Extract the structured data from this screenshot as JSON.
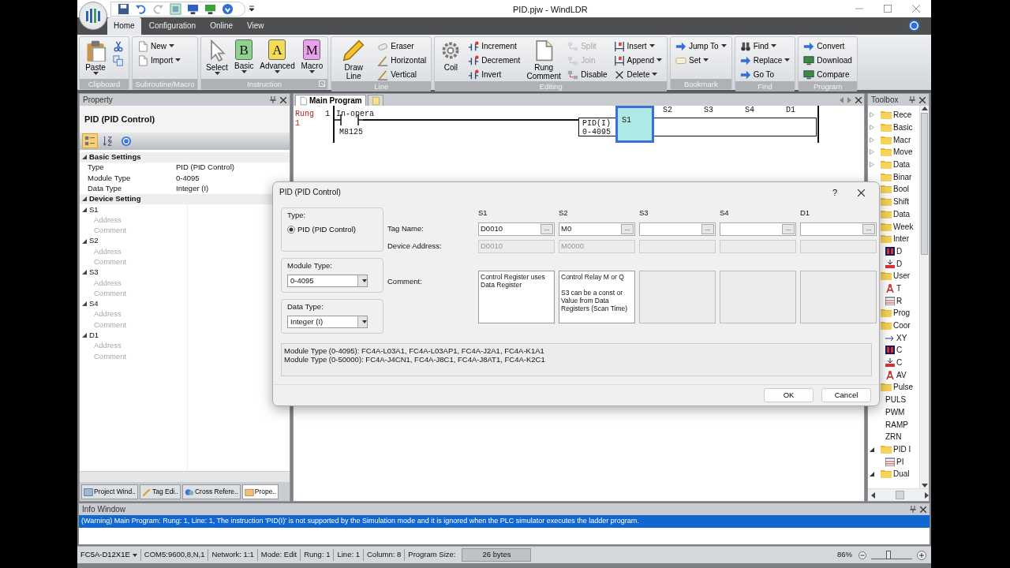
{
  "window": {
    "title": "PID.pjw - WindLDR"
  },
  "ribbon_tabs": [
    {
      "label": "Home",
      "selected": true
    },
    {
      "label": "Configuration",
      "selected": false
    },
    {
      "label": "Online",
      "selected": false
    },
    {
      "label": "View",
      "selected": false
    }
  ],
  "ribbon_groups": [
    {
      "label": "Clipboard",
      "launcher": false,
      "items": [
        {
          "kind": "large",
          "label": "Paste",
          "dropdown": true,
          "disabled": false
        },
        {
          "kind": "icon",
          "dropdown": false,
          "disabled": false
        },
        {
          "kind": "icon",
          "dropdown": false,
          "disabled": false
        }
      ]
    },
    {
      "label": "Subroutine/Macro",
      "launcher": false,
      "items": [
        {
          "kind": "small",
          "label": "New",
          "dropdown": true,
          "disabled": false
        },
        {
          "kind": "small",
          "label": "Import",
          "dropdown": true,
          "disabled": false
        }
      ]
    },
    {
      "label": "Instruction",
      "launcher": true,
      "items": [
        {
          "kind": "large",
          "label": "Select",
          "dropdown": true,
          "disabled": false
        },
        {
          "kind": "large",
          "label": "Basic",
          "glyph": "B",
          "dropdown": true,
          "disabled": false
        },
        {
          "kind": "large",
          "label": "Advanced",
          "glyph": "A",
          "dropdown": true,
          "disabled": false
        },
        {
          "kind": "large",
          "label": "Macro",
          "glyph": "M",
          "dropdown": true,
          "disabled": false
        }
      ]
    },
    {
      "label": "Line",
      "launcher": false,
      "items": [
        {
          "kind": "large",
          "label": "Draw Line",
          "dropdown": false,
          "disabled": false
        },
        {
          "kind": "small",
          "label": "Eraser",
          "dropdown": false,
          "disabled": false
        },
        {
          "kind": "small",
          "label": "Horizontal",
          "dropdown": false,
          "disabled": false
        },
        {
          "kind": "small",
          "label": "Vertical",
          "dropdown": false,
          "disabled": false
        }
      ]
    },
    {
      "label": "Editing",
      "launcher": false,
      "items": [
        {
          "kind": "large",
          "label": "Coil",
          "dropdown": false,
          "disabled": false
        },
        {
          "kind": "small",
          "label": "Increment",
          "dropdown": false,
          "disabled": false
        },
        {
          "kind": "small",
          "label": "Decrement",
          "dropdown": false,
          "disabled": false
        },
        {
          "kind": "small",
          "label": "Invert",
          "dropdown": false,
          "disabled": false
        },
        {
          "kind": "large",
          "label": "Rung Comment",
          "dropdown": false,
          "disabled": false
        },
        {
          "kind": "small",
          "label": "Split",
          "dropdown": false,
          "disabled": true
        },
        {
          "kind": "small",
          "label": "Join",
          "dropdown": false,
          "disabled": true
        },
        {
          "kind": "small",
          "label": "Disable",
          "dropdown": false,
          "disabled": false
        },
        {
          "kind": "small",
          "label": "Insert",
          "dropdown": true,
          "disabled": false
        },
        {
          "kind": "small",
          "label": "Append",
          "dropdown": true,
          "disabled": false
        },
        {
          "kind": "small",
          "label": "Delete",
          "dropdown": true,
          "disabled": false
        }
      ]
    },
    {
      "label": "Bookmark",
      "launcher": false,
      "items": [
        {
          "kind": "small",
          "label": "Jump To",
          "dropdown": true,
          "disabled": false
        },
        {
          "kind": "small",
          "label": "Set",
          "dropdown": true,
          "disabled": false
        }
      ]
    },
    {
      "label": "Find",
      "launcher": false,
      "items": [
        {
          "kind": "small",
          "label": "Find",
          "dropdown": true,
          "disabled": false
        },
        {
          "kind": "small",
          "label": "Replace",
          "dropdown": true,
          "disabled": false
        },
        {
          "kind": "small",
          "label": "Go To",
          "dropdown": false,
          "disabled": false
        }
      ]
    },
    {
      "label": "Program",
      "launcher": false,
      "items": [
        {
          "kind": "small",
          "label": "Convert",
          "dropdown": false,
          "disabled": false
        },
        {
          "kind": "small",
          "label": "Download",
          "dropdown": false,
          "disabled": false
        },
        {
          "kind": "small",
          "label": "Compare",
          "dropdown": false,
          "disabled": false
        }
      ]
    }
  ],
  "property_panel": {
    "title": "Property",
    "heading": "PID (PID Control)",
    "toolbar": [
      {
        "selected": true
      },
      {
        "selected": false
      },
      {
        "selected": false
      }
    ],
    "grid": [
      {
        "kind": "category",
        "label": "Basic Settings",
        "expanded": true,
        "children": [
          {
            "name": "Type",
            "value": "PID (PID Control)",
            "disabled": false
          },
          {
            "name": "Module Type",
            "value": "0-4095",
            "disabled": false
          },
          {
            "name": "Data Type",
            "value": "Integer (I)",
            "disabled": false
          }
        ]
      },
      {
        "kind": "category",
        "label": "Device Setting",
        "expanded": true
      },
      {
        "kind": "group",
        "label": "S1",
        "expanded": true,
        "children": [
          {
            "name": "Address",
            "disabled": true
          },
          {
            "name": "Comment",
            "disabled": true
          }
        ]
      },
      {
        "kind": "group",
        "label": "S2",
        "expanded": true,
        "children": [
          {
            "name": "Address",
            "disabled": true
          },
          {
            "name": "Comment",
            "disabled": true
          }
        ]
      },
      {
        "kind": "group",
        "label": "S3",
        "expanded": true,
        "children": [
          {
            "name": "Address",
            "disabled": true
          },
          {
            "name": "Comment",
            "disabled": true
          }
        ]
      },
      {
        "kind": "group",
        "label": "S4",
        "expanded": true,
        "children": [
          {
            "name": "Address",
            "disabled": true
          },
          {
            "name": "Comment",
            "disabled": true
          }
        ]
      },
      {
        "kind": "group",
        "label": "D1",
        "expanded": true,
        "children": [
          {
            "name": "Address",
            "disabled": true
          },
          {
            "name": "Comment",
            "disabled": true
          }
        ]
      }
    ],
    "tabs": [
      {
        "label": "Project Wind..",
        "selected": false
      },
      {
        "label": "Tag Edi..",
        "selected": false
      },
      {
        "label": "Cross Refere..",
        "selected": false
      },
      {
        "label": "Prope..",
        "selected": true
      }
    ]
  },
  "editor": {
    "tabs": [
      {
        "label": "Main Program",
        "selected": true
      },
      {
        "selected": false
      }
    ],
    "rung_header": "Rung",
    "rung_number": "1",
    "line_number": "1",
    "contact": {
      "label": "In-opera",
      "device": "M8125"
    },
    "instruction": {
      "name": "PID(I)",
      "module": "0-4095",
      "operands": [
        {
          "label": "S1",
          "selected": true
        },
        {
          "label": "S2",
          "selected": false
        },
        {
          "label": "S3",
          "selected": false
        },
        {
          "label": "S4",
          "selected": false
        },
        {
          "label": "D1",
          "selected": false
        }
      ]
    }
  },
  "dialog": {
    "title": "PID (PID Control)",
    "help": "?",
    "type_group": {
      "label": "Type:",
      "options": [
        {
          "label": "PID (PID Control)",
          "selected": true
        }
      ]
    },
    "module_type": {
      "label": "Module Type:",
      "value": "0-4095"
    },
    "data_type": {
      "label": "Data Type:",
      "value": "Integer (I)"
    },
    "row_labels": {
      "tag": "Tag Name:",
      "address": "Device Address:",
      "comment": "Comment:"
    },
    "operands": [
      {
        "label": "S1",
        "tag": "D0010",
        "browse": "...",
        "address": "D0010",
        "comment": "Control Register uses Data Register",
        "comment_disabled": false
      },
      {
        "label": "S2",
        "tag": "M0",
        "browse": "...",
        "address": "M0000",
        "comment": "Control Relay M or Q\n\nS3 can be a const or Value from Data Registers (Scan Time)",
        "comment_disabled": false
      },
      {
        "label": "S3",
        "browse": "...",
        "comment_disabled": true
      },
      {
        "label": "S4",
        "browse": "...",
        "comment_disabled": true
      },
      {
        "label": "D1",
        "browse": "...",
        "comment_disabled": true
      }
    ],
    "note": [
      "Module Type (0-4095): FC4A-L03A1, FC4A-L03AP1, FC4A-J2A1, FC4A-K1A1",
      "Module Type (0-50000): FC4A-J4CN1, FC4A-J8C1, FC4A-J8AT1, FC4A-K2C1"
    ],
    "buttons": [
      {
        "label": "OK"
      },
      {
        "label": "Cancel"
      }
    ]
  },
  "toolbox": {
    "title": "Toolbox",
    "items": [
      {
        "label": "Rece",
        "expanded": false
      },
      {
        "label": "Basic",
        "expanded": false
      },
      {
        "label": "Macr",
        "expanded": false
      },
      {
        "label": "Move",
        "expanded": false
      },
      {
        "label": "Data",
        "expanded": false
      },
      {
        "label": "Binar"
      },
      {
        "label": "Bool"
      },
      {
        "label": "Shift"
      },
      {
        "label": "Data"
      },
      {
        "label": "Week"
      },
      {
        "label": "Inter",
        "children": [
          {
            "label": "D",
            "kind": "icon"
          },
          {
            "label": "D",
            "kind": "icon"
          }
        ]
      },
      {
        "label": "User",
        "children": [
          {
            "label": "T",
            "kind": "icon"
          },
          {
            "label": "R",
            "kind": "icon"
          }
        ]
      },
      {
        "label": "Prog"
      },
      {
        "label": "Coor",
        "children": [
          {
            "label": "XY",
            "kind": "icon"
          },
          {
            "label": "C",
            "kind": "icon"
          },
          {
            "label": "C",
            "kind": "icon"
          },
          {
            "label": "AV",
            "kind": "icon"
          }
        ]
      },
      {
        "label": "Pulse",
        "children": [
          {
            "label": "PULS",
            "kind": "plain"
          },
          {
            "label": "PWM",
            "kind": "plain"
          },
          {
            "label": "RAMP",
            "kind": "plain"
          },
          {
            "label": "ZRN",
            "kind": "plain"
          }
        ]
      },
      {
        "label": "PID I",
        "expanded": true,
        "children": [
          {
            "label": "PI",
            "kind": "icon"
          }
        ]
      },
      {
        "label": "Dual",
        "expanded": true
      }
    ]
  },
  "info_window": {
    "title": "Info Window",
    "messages": [
      {
        "text": "(Warning) Main Program: Rung: 1, Line: 1, The instruction 'PID(I)' is not supported by the Simulation mode and it is ignored when the PLC simulator executes the ladder program.",
        "selected": true
      }
    ]
  },
  "status_bar": {
    "model": "FC5A-D12X1E",
    "comm": "COM5:9600,8,N,1",
    "network": "Network: 1:1",
    "mode": "Mode: Edit",
    "rung": "Rung: 1",
    "line": "Line: 1",
    "column": "Column: 8",
    "size_label": "Program Size:",
    "size": "26 bytes",
    "zoom": "86%",
    "zoom_slider": {
      "level": 0.45
    }
  }
}
